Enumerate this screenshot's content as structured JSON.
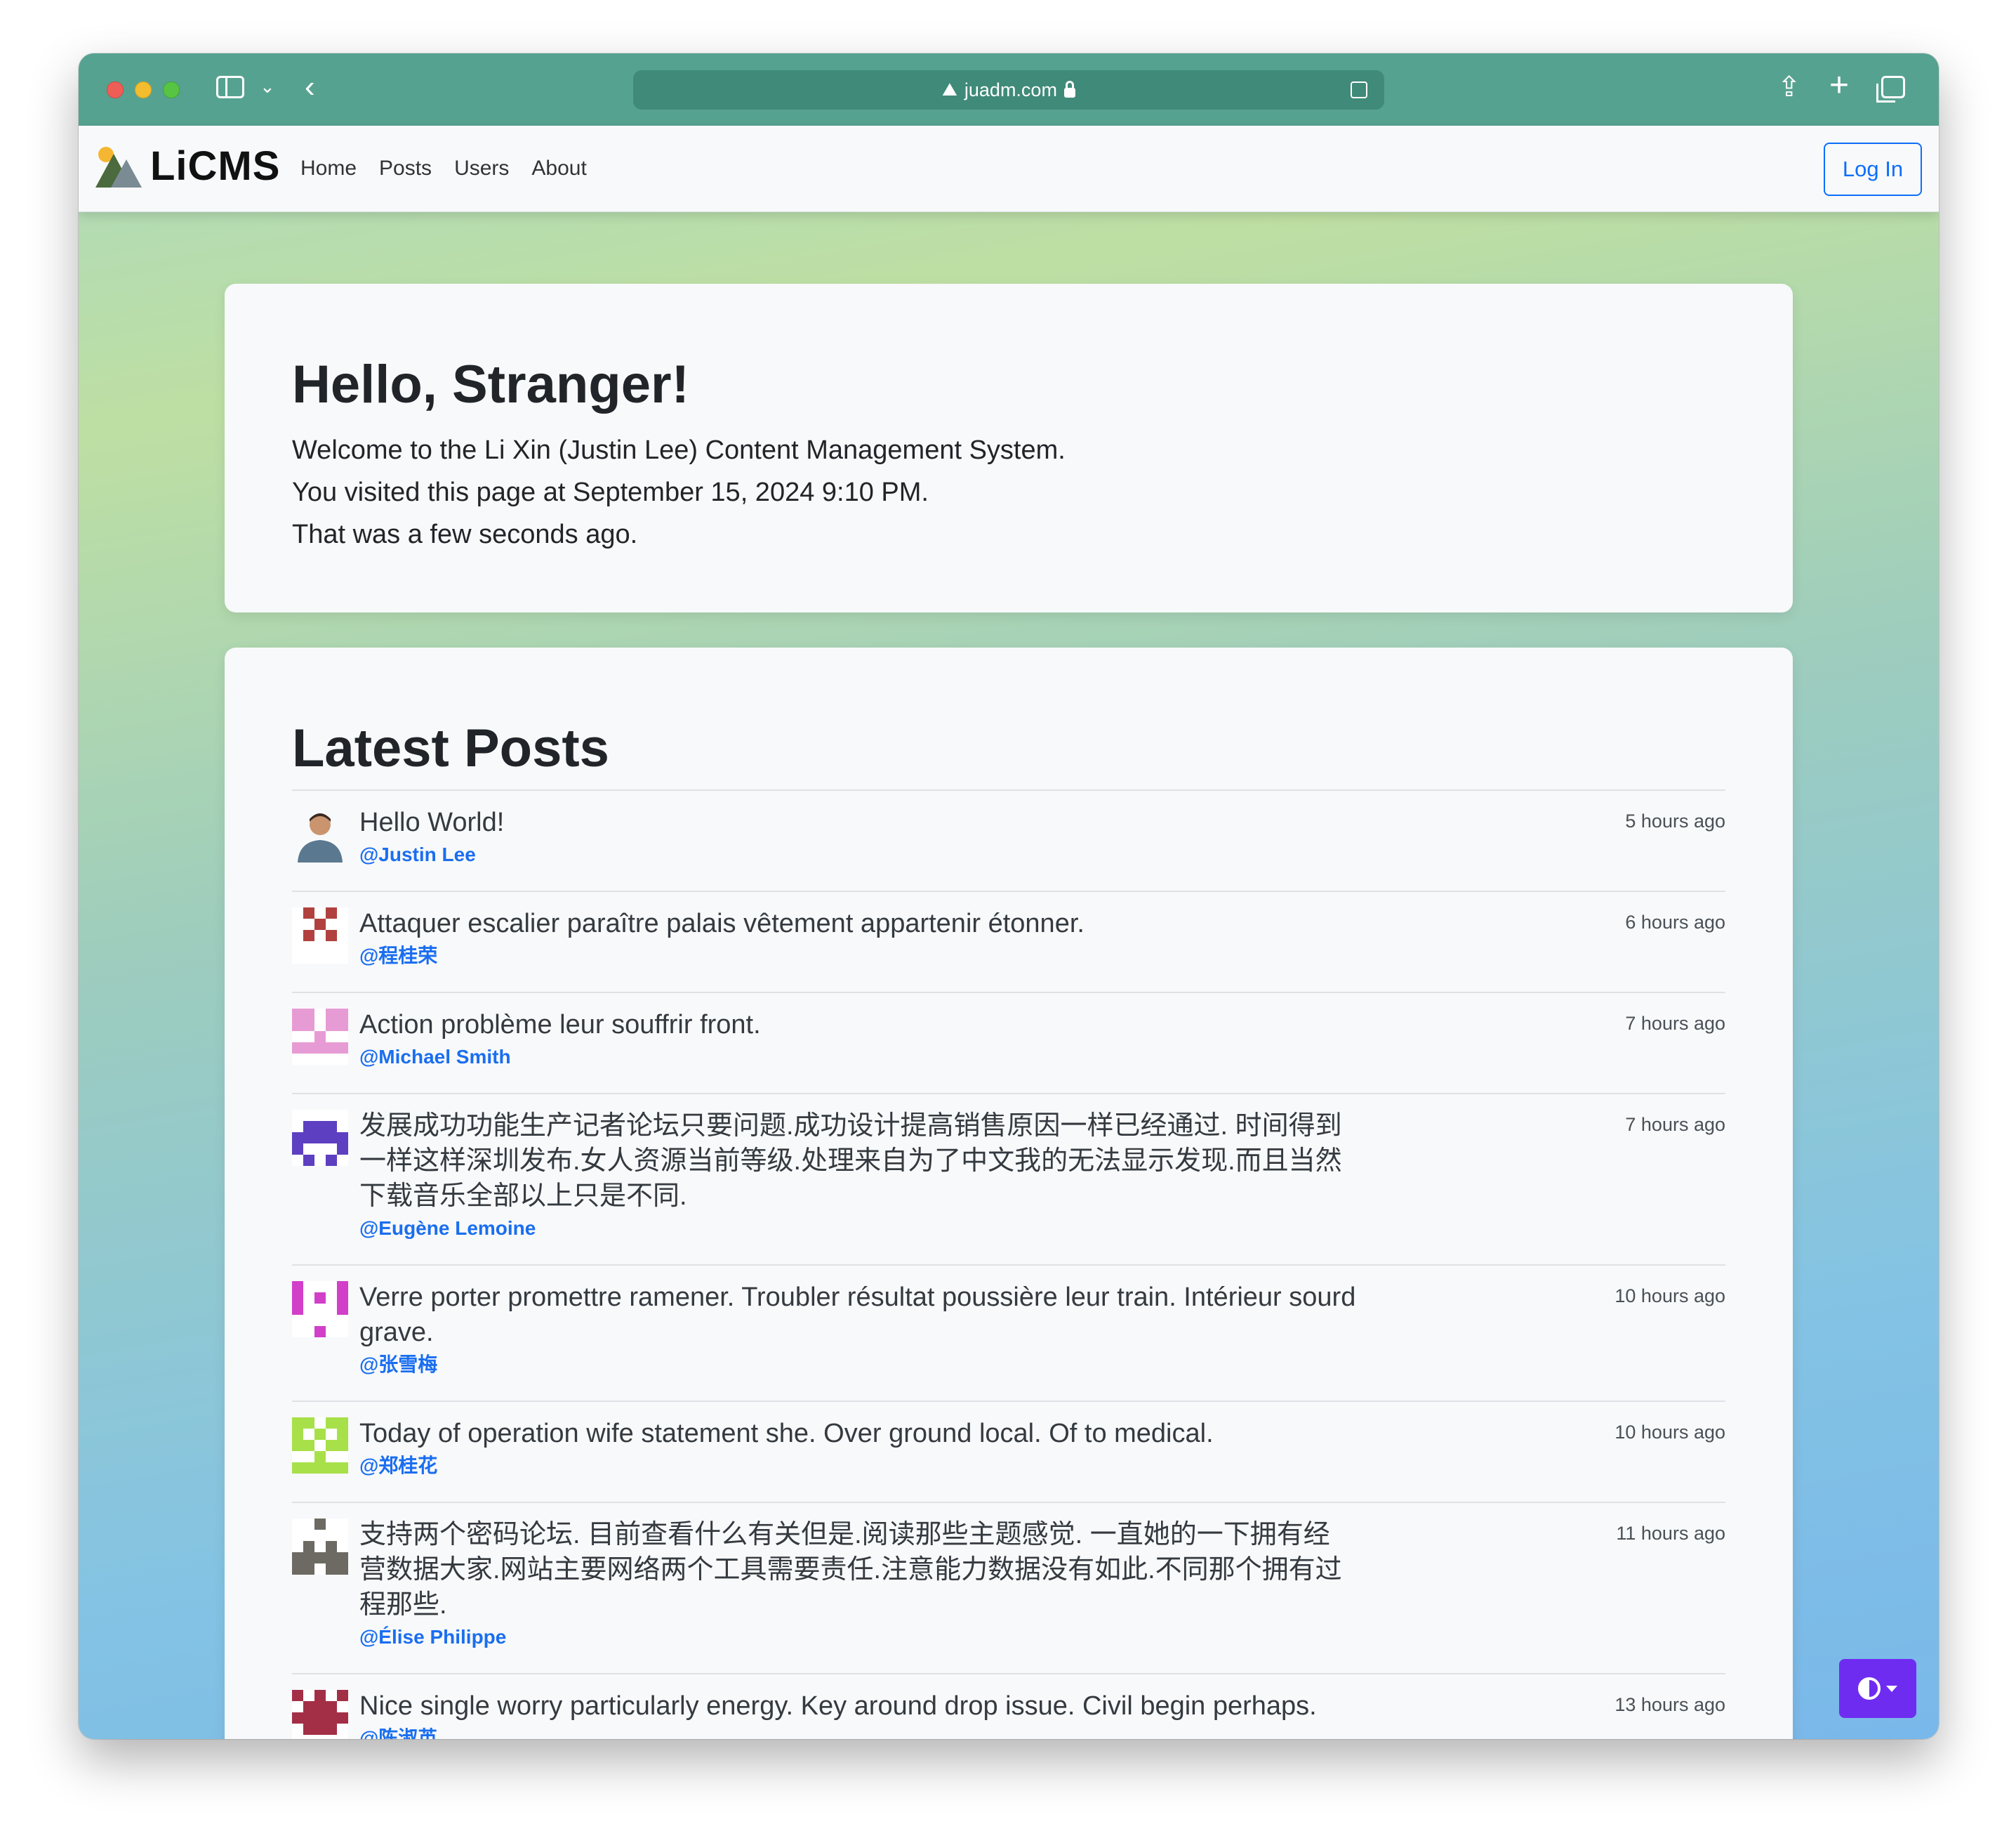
{
  "browser": {
    "url": "juadm.com"
  },
  "navbar": {
    "brand": "LiCMS",
    "links": [
      "Home",
      "Posts",
      "Users",
      "About"
    ],
    "login_label": "Log In"
  },
  "hello": {
    "title": "Hello, Stranger!",
    "lines": [
      "Welcome to the Li Xin (Justin Lee) Content Management System.",
      "You visited this page at September 15, 2024 9:10 PM.",
      "That was a few seconds ago."
    ]
  },
  "posts": {
    "title": "Latest Posts",
    "items": [
      {
        "title": "Hello World!",
        "author": "@Justin Lee",
        "time": "5 hours ago",
        "avatar_color": "#5a7890",
        "avatar_icon": "person-photo-icon"
      },
      {
        "title": "Attaquer escalier paraître palais vêtement appartenir étonner.",
        "author": "@程桂荣",
        "time": "6 hours ago",
        "avatar_color": "#b0413e",
        "avatar_icon": "identicon-icon"
      },
      {
        "title": "Action problème leur souffrir front.",
        "author": "@Michael Smith",
        "time": "7 hours ago",
        "avatar_color": "#e79bd4",
        "avatar_icon": "identicon-icon"
      },
      {
        "title": "发展成功功能生产记者论坛只要问题.成功设计提高销售原因一样已经通过. 时间得到一样这样深圳发布.女人资源当前等级.处理来自为了中文我的无法显示发现.而且当然下载音乐全部以上只是不同.",
        "author": "@Eugène Lemoine",
        "time": "7 hours ago",
        "avatar_color": "#5d3fc1",
        "avatar_icon": "identicon-icon"
      },
      {
        "title": "Verre porter promettre ramener. Troubler résultat poussière leur train. Intérieur sourd grave.",
        "author": "@张雪梅",
        "time": "10 hours ago",
        "avatar_color": "#d23fc9",
        "avatar_icon": "identicon-icon"
      },
      {
        "title": "Today of operation wife statement she. Over ground local. Of to medical.",
        "author": "@郑桂花",
        "time": "10 hours ago",
        "avatar_color": "#a8e04a",
        "avatar_icon": "identicon-icon"
      },
      {
        "title": "支持两个密码论坛. 目前查看什么有关但是.阅读那些主题感觉. 一直她的一下拥有经营数据大家.网站主要网络两个工具需要责任.注意能力数据没有如此.不同那个拥有过程那些.",
        "author": "@Élise Philippe",
        "time": "11 hours ago",
        "avatar_color": "#6d6a63",
        "avatar_icon": "identicon-icon"
      },
      {
        "title": "Nice single worry particularly energy. Key around drop issue. Civil begin perhaps.",
        "author": "@陈淑英",
        "time": "13 hours ago",
        "avatar_color": "#a32f47",
        "avatar_icon": "identicon-icon"
      }
    ]
  },
  "theme_toggle": {
    "icon": "contrast-icon"
  },
  "colors": {
    "titlebar": "#56a290",
    "accent": "#0d6efd",
    "theme_button": "#6f2cf1"
  }
}
